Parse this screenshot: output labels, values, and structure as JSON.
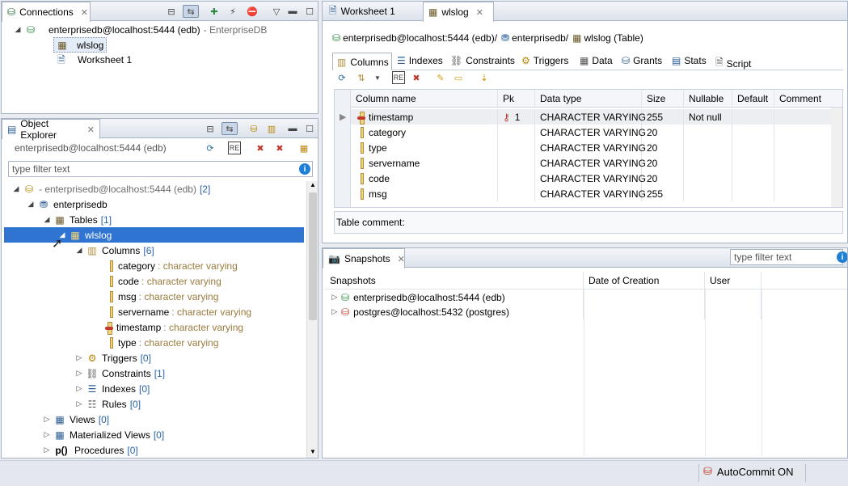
{
  "connections": {
    "title": "Connections",
    "tree": [
      {
        "label": "enterprisedb@localhost:5444 (edb)",
        "suffix": "- EnterpriseDB"
      },
      {
        "label": "wlslog"
      },
      {
        "label": "Worksheet 1"
      }
    ]
  },
  "object_explorer": {
    "title": "Object Explorer",
    "connection_label": "enterprisedb@localhost:5444 (edb)",
    "filter_placeholder": "type filter text",
    "tree": {
      "root": {
        "label": "- enterprisedb@localhost:5444 (edb)",
        "count": "[2]"
      },
      "db": "enterprisedb",
      "tables": {
        "label": "Tables",
        "count": "[1]"
      },
      "wlslog": "wlslog",
      "columns": {
        "label": "Columns",
        "count": "[6]"
      },
      "cols": [
        {
          "name": "category",
          "type": ": character varying"
        },
        {
          "name": "code",
          "type": ": character varying"
        },
        {
          "name": "msg",
          "type": ": character varying"
        },
        {
          "name": "servername",
          "type": ": character varying"
        },
        {
          "name": "timestamp",
          "type": ": character varying"
        },
        {
          "name": "type",
          "type": ": character varying"
        }
      ],
      "triggers": {
        "label": "Triggers",
        "count": "[0]"
      },
      "constraints": {
        "label": "Constraints",
        "count": "[1]"
      },
      "indexes": {
        "label": "Indexes",
        "count": "[0]"
      },
      "rules": {
        "label": "Rules",
        "count": "[0]"
      },
      "views": {
        "label": "Views",
        "count": "[0]"
      },
      "mviews": {
        "label": "Materialized Views",
        "count": "[0]"
      },
      "procedures": {
        "label": "Procedures",
        "count": "[0]"
      }
    }
  },
  "editor": {
    "tabs": [
      "Worksheet 1",
      "wlslog"
    ],
    "breadcrumb": {
      "conn": "enterprisedb@localhost:5444 (edb)/",
      "schema": "enterprisedb/",
      "table": "wlslog (Table)"
    },
    "subtabs": [
      "Columns",
      "Indexes",
      "Constraints",
      "Triggers",
      "Data",
      "Grants",
      "Stats",
      "Script"
    ],
    "headers": [
      "Column name",
      "Pk",
      "Data type",
      "Size",
      "Nullable",
      "Default",
      "Comment"
    ],
    "rows": [
      {
        "name": "timestamp",
        "pk": "1",
        "type": "CHARACTER VARYING",
        "size": "255",
        "nullable": "Not null"
      },
      {
        "name": "category",
        "pk": "",
        "type": "CHARACTER VARYING",
        "size": "20",
        "nullable": ""
      },
      {
        "name": "type",
        "pk": "",
        "type": "CHARACTER VARYING",
        "size": "20",
        "nullable": ""
      },
      {
        "name": "servername",
        "pk": "",
        "type": "CHARACTER VARYING",
        "size": "20",
        "nullable": ""
      },
      {
        "name": "code",
        "pk": "",
        "type": "CHARACTER VARYING",
        "size": "20",
        "nullable": ""
      },
      {
        "name": "msg",
        "pk": "",
        "type": "CHARACTER VARYING",
        "size": "255",
        "nullable": ""
      }
    ],
    "table_comment_label": "Table comment:"
  },
  "snapshots": {
    "title": "Snapshots",
    "filter_placeholder": "type filter text",
    "headers": [
      "Snapshots",
      "Date of Creation",
      "User"
    ],
    "items": [
      "enterprisedb@localhost:5444 (edb)",
      "postgres@localhost:5432 (postgres)"
    ]
  },
  "status": {
    "autocommit": "AutoCommit ON"
  }
}
